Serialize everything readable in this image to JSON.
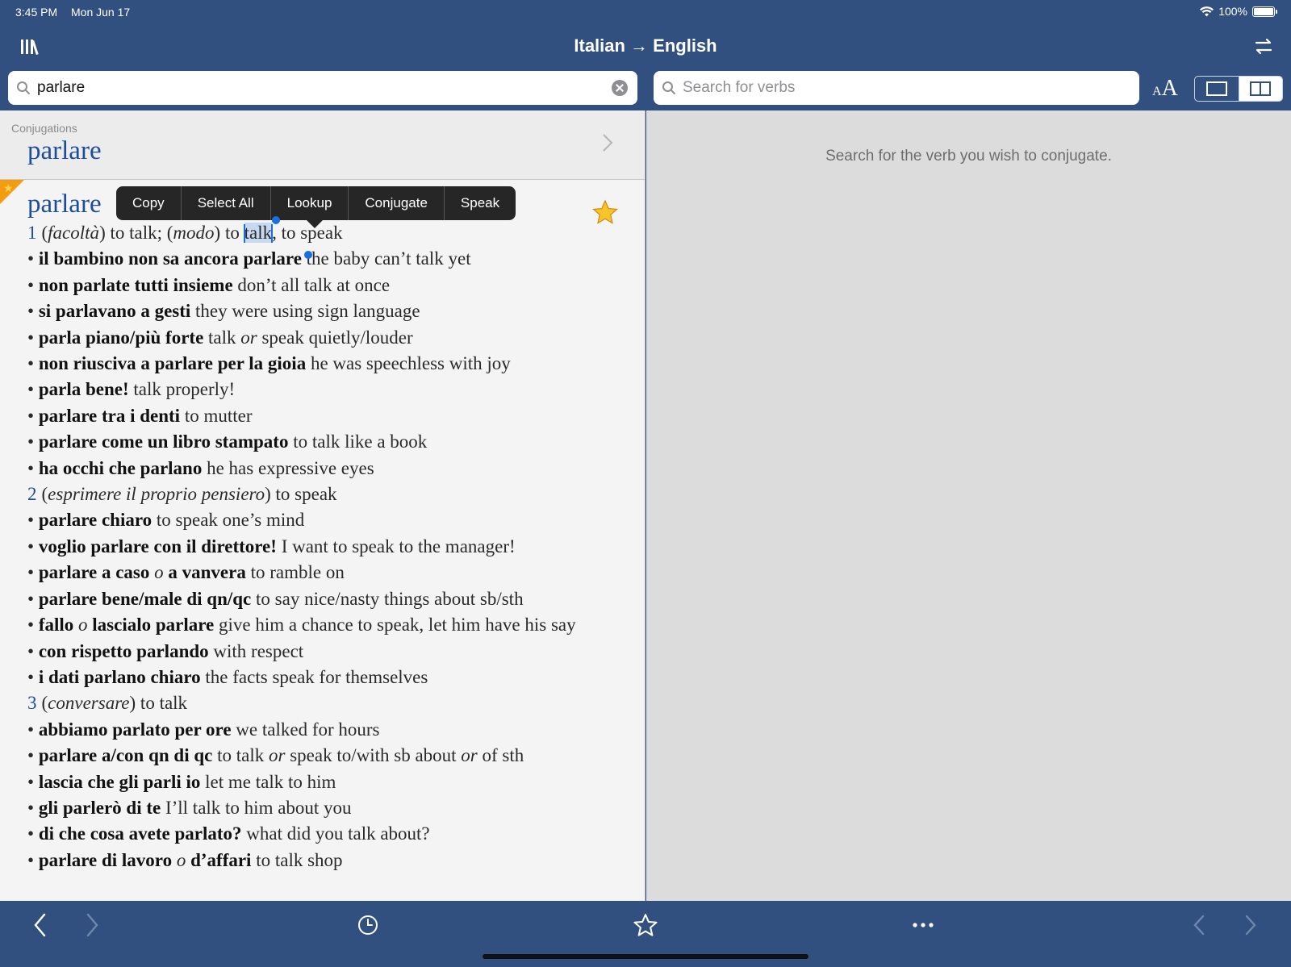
{
  "status_bar": {
    "time": "3:45 PM",
    "date": "Mon Jun 17",
    "battery": "100%"
  },
  "nav": {
    "title": "Italian → English",
    "library_icon": "library-icon",
    "swap_icon": "swap-direction-icon"
  },
  "search_left": {
    "value": "parlare",
    "placeholder": ""
  },
  "search_right": {
    "value": "",
    "placeholder": "Search for verbs"
  },
  "font_size": {
    "small": "A",
    "big": "A"
  },
  "conjugations": {
    "caption": "Conjugations",
    "verb": "parlare"
  },
  "context_menu": {
    "items": [
      "Copy",
      "Select All",
      "Lookup",
      "Conjugate",
      "Speak"
    ]
  },
  "entry": {
    "headword": "parlare",
    "sense1": {
      "num": "1",
      "gloss_a": "facoltà",
      "t1": ") to talk;  (",
      "gloss_b": "modo",
      "t2": ") to ",
      "selected": "talk",
      "t3": ", to speak"
    },
    "examples1": [
      {
        "it": "il bambino non sa ancora parlare",
        "en": " the baby can’t talk yet"
      },
      {
        "it": "non parlate tutti insieme",
        "en": " don’t all talk at once"
      },
      {
        "it": "si parlavano a gesti",
        "en": " they were using sign language"
      },
      {
        "it": "parla piano/più forte",
        "en_pre": " talk ",
        "or": "or",
        "en": " speak quietly/louder"
      },
      {
        "it": "non riusciva a parlare per la gioia",
        "en": " he was speechless with joy"
      },
      {
        "it": "parla bene!",
        "en": " talk properly!"
      },
      {
        "it": "parlare tra i denti",
        "en": " to mutter"
      },
      {
        "it": "parlare come un libro stampato",
        "en": " to talk like a book"
      },
      {
        "it": "ha occhi che parlano",
        "en": " he has expressive eyes"
      }
    ],
    "sense2": {
      "num": "2",
      "gloss": "esprimere il proprio pensiero",
      "t": ") to speak"
    },
    "examples2": [
      {
        "it": "parlare chiaro",
        "en": " to speak one’s mind"
      },
      {
        "it": "voglio parlare con il direttore!",
        "en": " I want to speak to the manager!"
      },
      {
        "it_a": "parlare a caso",
        "o": "o",
        "it_b": "a vanvera",
        "en": " to ramble on"
      },
      {
        "it": "parlare bene/male di qn/qc",
        "en": " to say nice/nasty things about sb/sth"
      },
      {
        "it_a": "fallo",
        "o": "o",
        "it_b": "lascialo parlare",
        "en": " give him a chance to speak, let him have his say"
      },
      {
        "it": "con rispetto parlando",
        "en": " with respect"
      },
      {
        "it": "i dati parlano chiaro",
        "en": " the facts speak for themselves"
      }
    ],
    "sense3": {
      "num": "3",
      "gloss": "conversare",
      "t": ") to talk"
    },
    "examples3": [
      {
        "it": "abbiamo parlato per ore",
        "en": " we talked for hours"
      },
      {
        "it": "parlare a/con qn di qc",
        "en_a": " to talk ",
        "or1": "or",
        "en_b": " speak to/with sb about ",
        "or2": "or",
        "en_c": " of sth"
      },
      {
        "it": "lascia che gli parli io",
        "en": " let me talk to him"
      },
      {
        "it": "gli parlerò di te",
        "en": " I’ll talk to him about you"
      },
      {
        "it": "di che cosa avete parlato?",
        "en": " what did you talk about?"
      },
      {
        "it_a": "parlare di lavoro",
        "o": "o",
        "it_b": "d’affari",
        "en": " to talk shop"
      }
    ]
  },
  "right_panel": {
    "hint": "Search for the verb you wish to conjugate."
  },
  "toolbar": {
    "icons": [
      "back-icon",
      "forward-icon",
      "history-icon",
      "favorites-icon",
      "more-icon",
      "prev-entry-icon",
      "next-entry-icon"
    ]
  },
  "colors": {
    "bar": "#31507f",
    "accent": "#1c4c9a",
    "selection": "#c6d9f1"
  }
}
